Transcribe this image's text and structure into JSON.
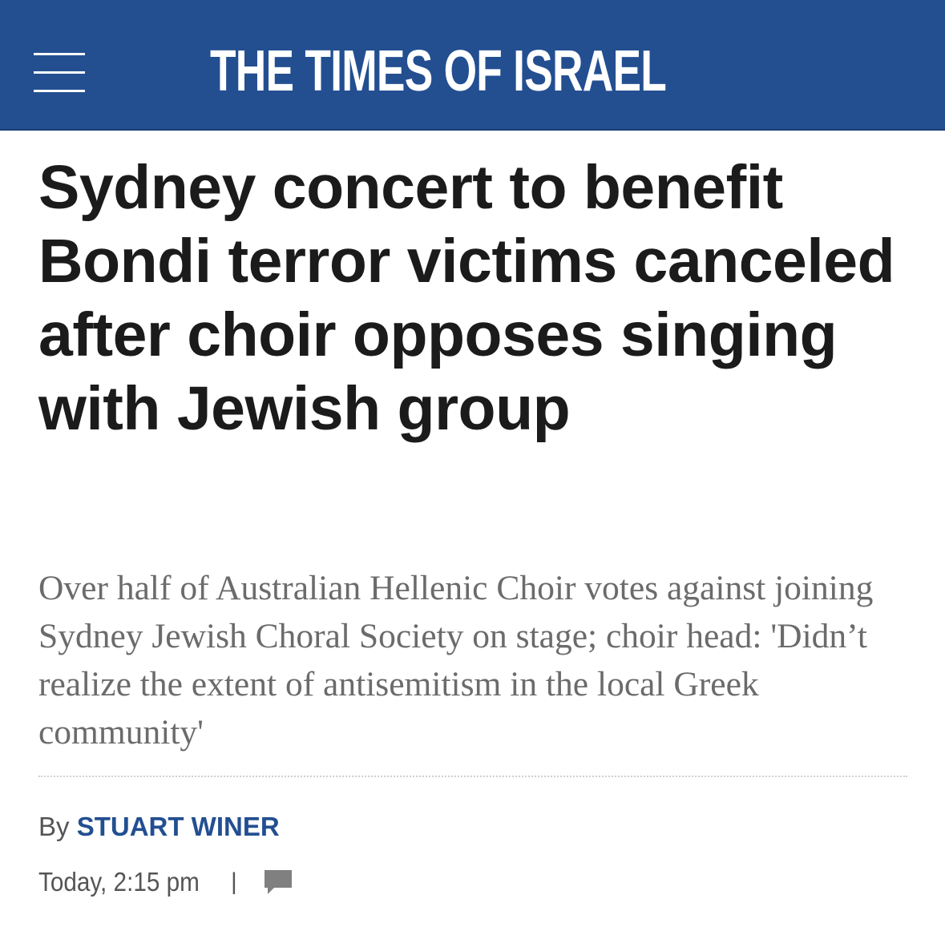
{
  "header": {
    "site_title": "THE TIMES OF ISRAEL",
    "menu_icon": "hamburger-menu-icon",
    "background_color": "#234f91"
  },
  "article": {
    "headline": "Sydney concert to benefit Bondi terror victims canceled after choir opposes singing with Jewish group",
    "subhead": "Over half of Australian Hellenic Choir votes against joining Sydney Jewish Choral Society on stage; choir head: 'Didn’t realize the extent of antisemitism in the local Greek community'",
    "byline_prefix": "By",
    "author": "STUART WINER",
    "timestamp": "Today, 2:15 pm",
    "separator": "|",
    "comments_icon": "comment-bubble-icon",
    "author_color": "#234f91"
  }
}
